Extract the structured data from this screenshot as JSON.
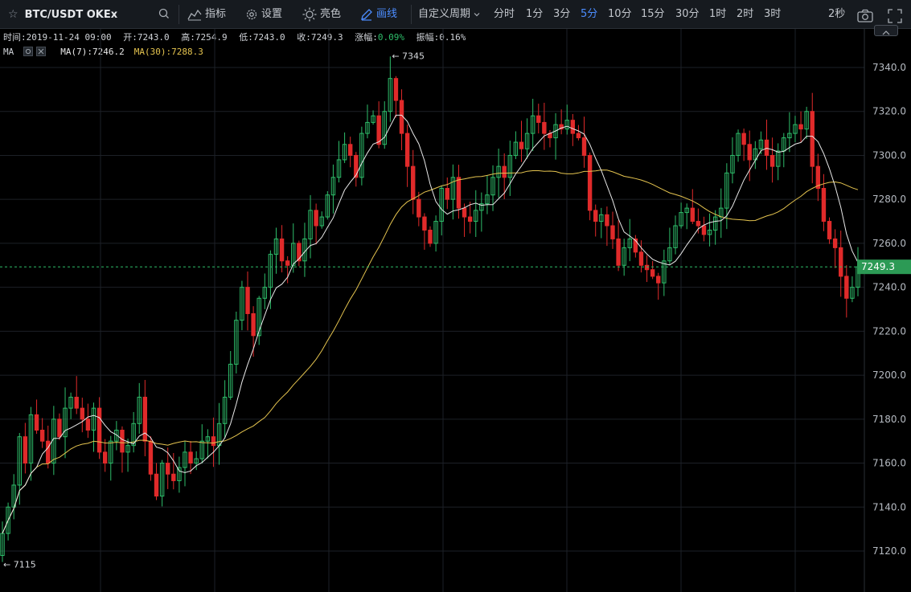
{
  "toolbar": {
    "symbol": "BTC/USDT OKEx",
    "star_icon": "☆",
    "indicators_label": "指标",
    "settings_label": "设置",
    "theme_label": "亮色",
    "draw_label": "画线",
    "custom_period_label": "自定义周期",
    "periods": [
      "分时",
      "1分",
      "3分",
      "5分",
      "10分",
      "15分",
      "30分",
      "1时",
      "2时",
      "3时"
    ],
    "active_period": "5分",
    "refresh_label": "2秒",
    "accent_color": "#4c8dff"
  },
  "info": {
    "time_label": "时间:",
    "time": "2019-11-24 09:00",
    "open_label": "开:",
    "open": "7243.0",
    "high_label": "高:",
    "high": "7254.9",
    "low_label": "低:",
    "low": "7243.0",
    "close_label": "收:",
    "close": "7249.3",
    "change_label": "涨幅:",
    "change": "0.09%",
    "amplitude_label": "振幅:",
    "amplitude": "0.16%"
  },
  "ma": {
    "label": "MA",
    "ma7_label": "MA(7):",
    "ma7_value": "7246.2",
    "ma7_color": "#e8e8e8",
    "ma30_label": "MA(30):",
    "ma30_value": "7288.3",
    "ma30_color": "#e5c44f"
  },
  "chart_data": {
    "type": "candlestick",
    "ylim": [
      7110,
      7352
    ],
    "y_ticks": [
      7120,
      7140,
      7160,
      7180,
      7200,
      7220,
      7240,
      7260,
      7280,
      7300,
      7320,
      7340
    ],
    "y_tick_labels": [
      "7120.0",
      "7140.0",
      "7160.0",
      "7180.0",
      "7200.0",
      "7220.0",
      "7240.0",
      "7260.0",
      "7280.0",
      "7300.0",
      "7320.0",
      "7340.0"
    ],
    "current_price": 7249.3,
    "current_price_label": "7249.3",
    "max_marker": {
      "value": 7345,
      "label": "← 7345"
    },
    "min_marker": {
      "value": 7115,
      "label": "← 7115"
    },
    "up_color": "#2ebd6a",
    "down_color": "#e02a2a",
    "closes": [
      7128,
      7140,
      7150,
      7172,
      7160,
      7182,
      7175,
      7170,
      7160,
      7180,
      7172,
      7185,
      7190,
      7185,
      7180,
      7175,
      7185,
      7165,
      7160,
      7170,
      7175,
      7165,
      7168,
      7178,
      7190,
      7170,
      7155,
      7145,
      7160,
      7155,
      7152,
      7158,
      7165,
      7160,
      7162,
      7170,
      7172,
      7168,
      7178,
      7190,
      7205,
      7225,
      7240,
      7228,
      7218,
      7235,
      7240,
      7255,
      7262,
      7252,
      7250,
      7260,
      7252,
      7262,
      7275,
      7268,
      7272,
      7282,
      7290,
      7298,
      7305,
      7300,
      7290,
      7310,
      7315,
      7318,
      7305,
      7320,
      7335,
      7325,
      7310,
      7295,
      7280,
      7272,
      7266,
      7260,
      7270,
      7285,
      7280,
      7290,
      7276,
      7272,
      7270,
      7275,
      7278,
      7282,
      7290,
      7295,
      7290,
      7300,
      7306,
      7303,
      7310,
      7318,
      7315,
      7310,
      7308,
      7314,
      7312,
      7316,
      7310,
      7308,
      7300,
      7275,
      7270,
      7273,
      7268,
      7262,
      7250,
      7258,
      7262,
      7256,
      7250,
      7248,
      7245,
      7242,
      7252,
      7258,
      7268,
      7274,
      7276,
      7270,
      7268,
      7264,
      7266,
      7272,
      7276,
      7292,
      7300,
      7310,
      7305,
      7298,
      7303,
      7307,
      7300,
      7295,
      7302,
      7308,
      7310,
      7314,
      7312,
      7320,
      7295,
      7285,
      7270,
      7262,
      7258,
      7245,
      7235,
      7240,
      7249.3
    ]
  }
}
